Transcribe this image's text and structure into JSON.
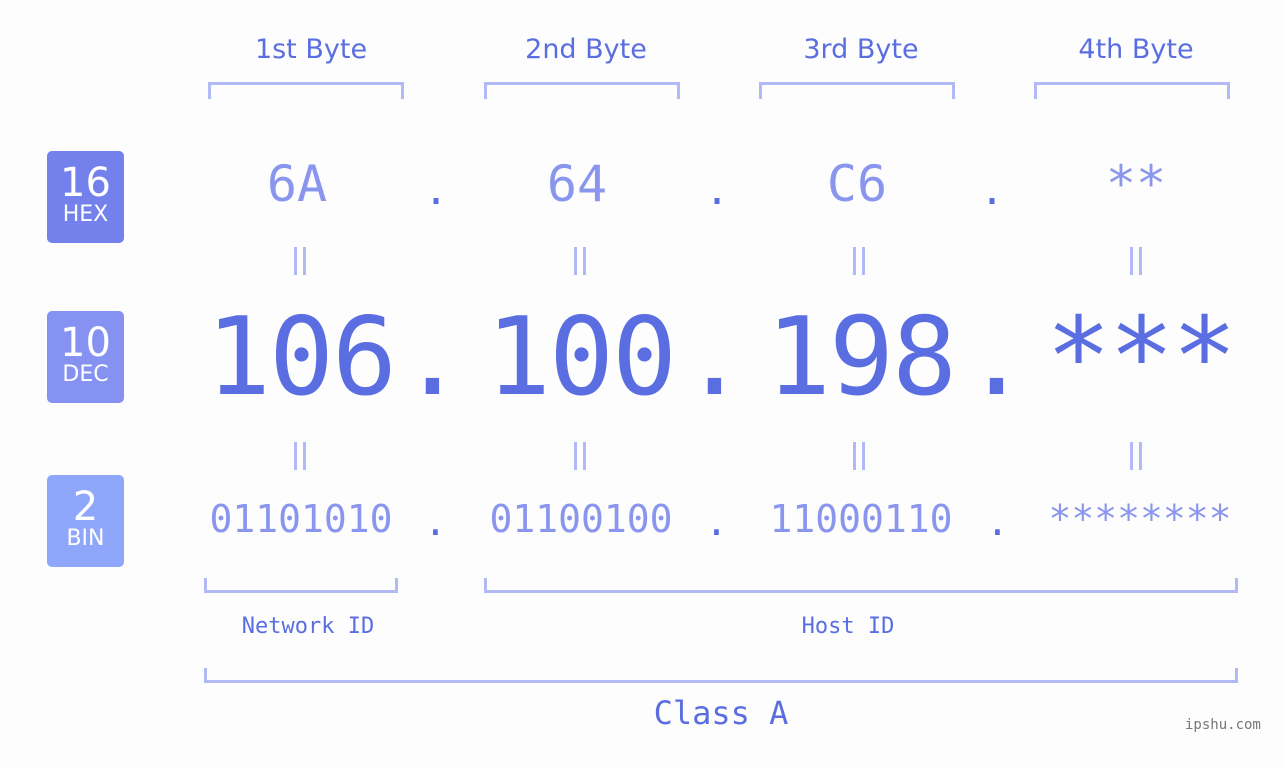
{
  "bytes": {
    "headers": [
      "1st Byte",
      "2nd Byte",
      "3rd Byte",
      "4th Byte"
    ]
  },
  "badges": {
    "hex": {
      "num": "16",
      "label": "HEX",
      "color": "#7480eb"
    },
    "dec": {
      "num": "10",
      "label": "DEC",
      "color": "#8592f2"
    },
    "bin": {
      "num": "2",
      "label": "BIN",
      "color": "#8fa7fb"
    }
  },
  "hex": [
    "6A",
    "64",
    "C6",
    "**"
  ],
  "dec": [
    "106",
    "100",
    "198",
    "***"
  ],
  "bin": [
    "01101010",
    "01100100",
    "11000110",
    "********"
  ],
  "separator": ".",
  "labels": {
    "network_id": "Network ID",
    "host_id": "Host ID",
    "class": "Class A"
  },
  "watermark": "ipshu.com"
}
